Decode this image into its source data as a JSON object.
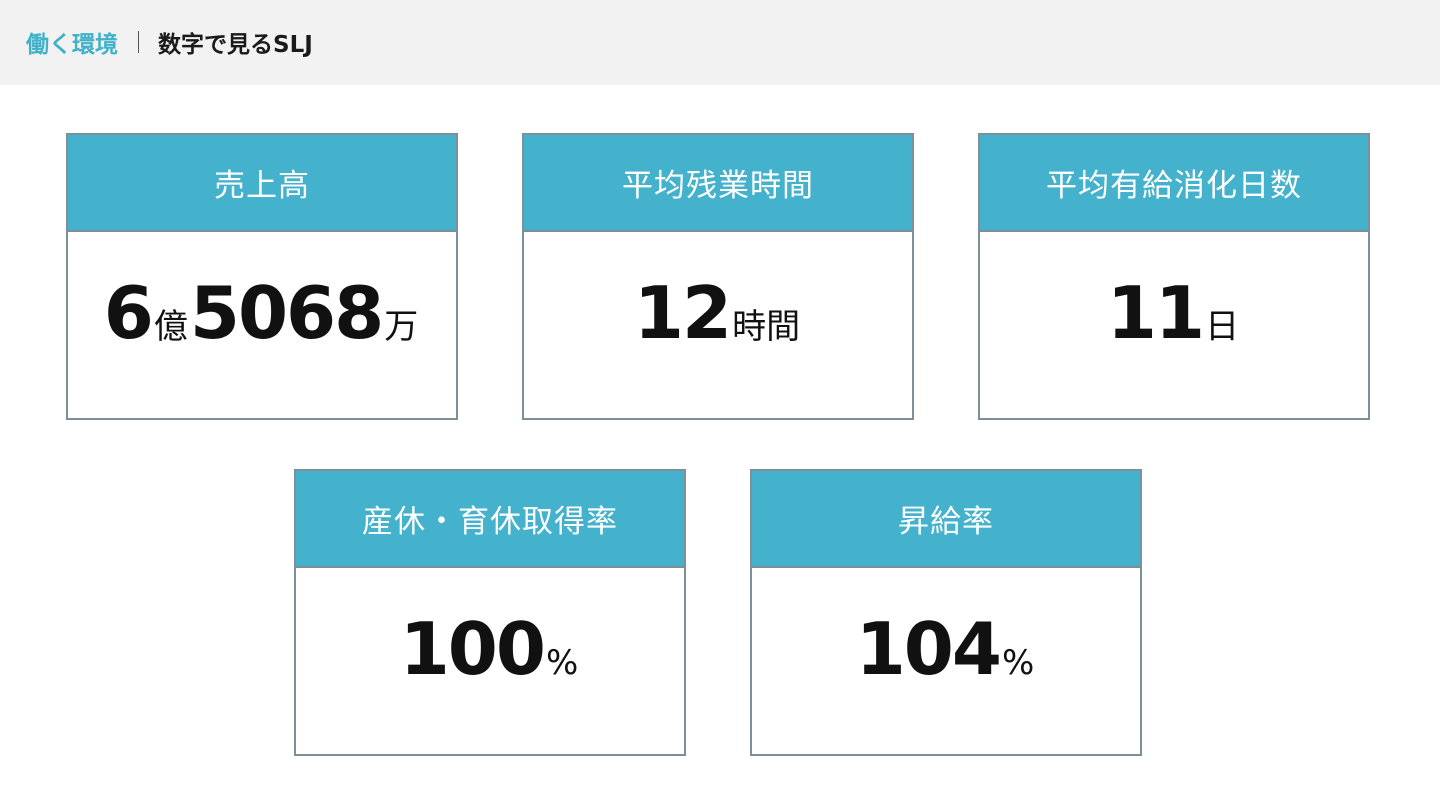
{
  "header": {
    "section": "働く環境",
    "page_title": "数字で見るSLJ"
  },
  "cards": [
    {
      "label": "売上高",
      "parts": [
        "6",
        "億",
        "5068",
        "万"
      ]
    },
    {
      "label": "平均残業時間",
      "parts": [
        "12",
        "時間"
      ]
    },
    {
      "label": "平均有給消化日数",
      "parts": [
        "11",
        "日"
      ]
    },
    {
      "label": "産休・育休取得率",
      "parts": [
        "100",
        "%"
      ]
    },
    {
      "label": "昇給率",
      "parts": [
        "104",
        "%"
      ]
    }
  ],
  "colors": {
    "accent": "#44b2cc",
    "section_text": "#3fb2c9",
    "border": "#7d8f99",
    "header_bg": "#f2f2f2"
  }
}
